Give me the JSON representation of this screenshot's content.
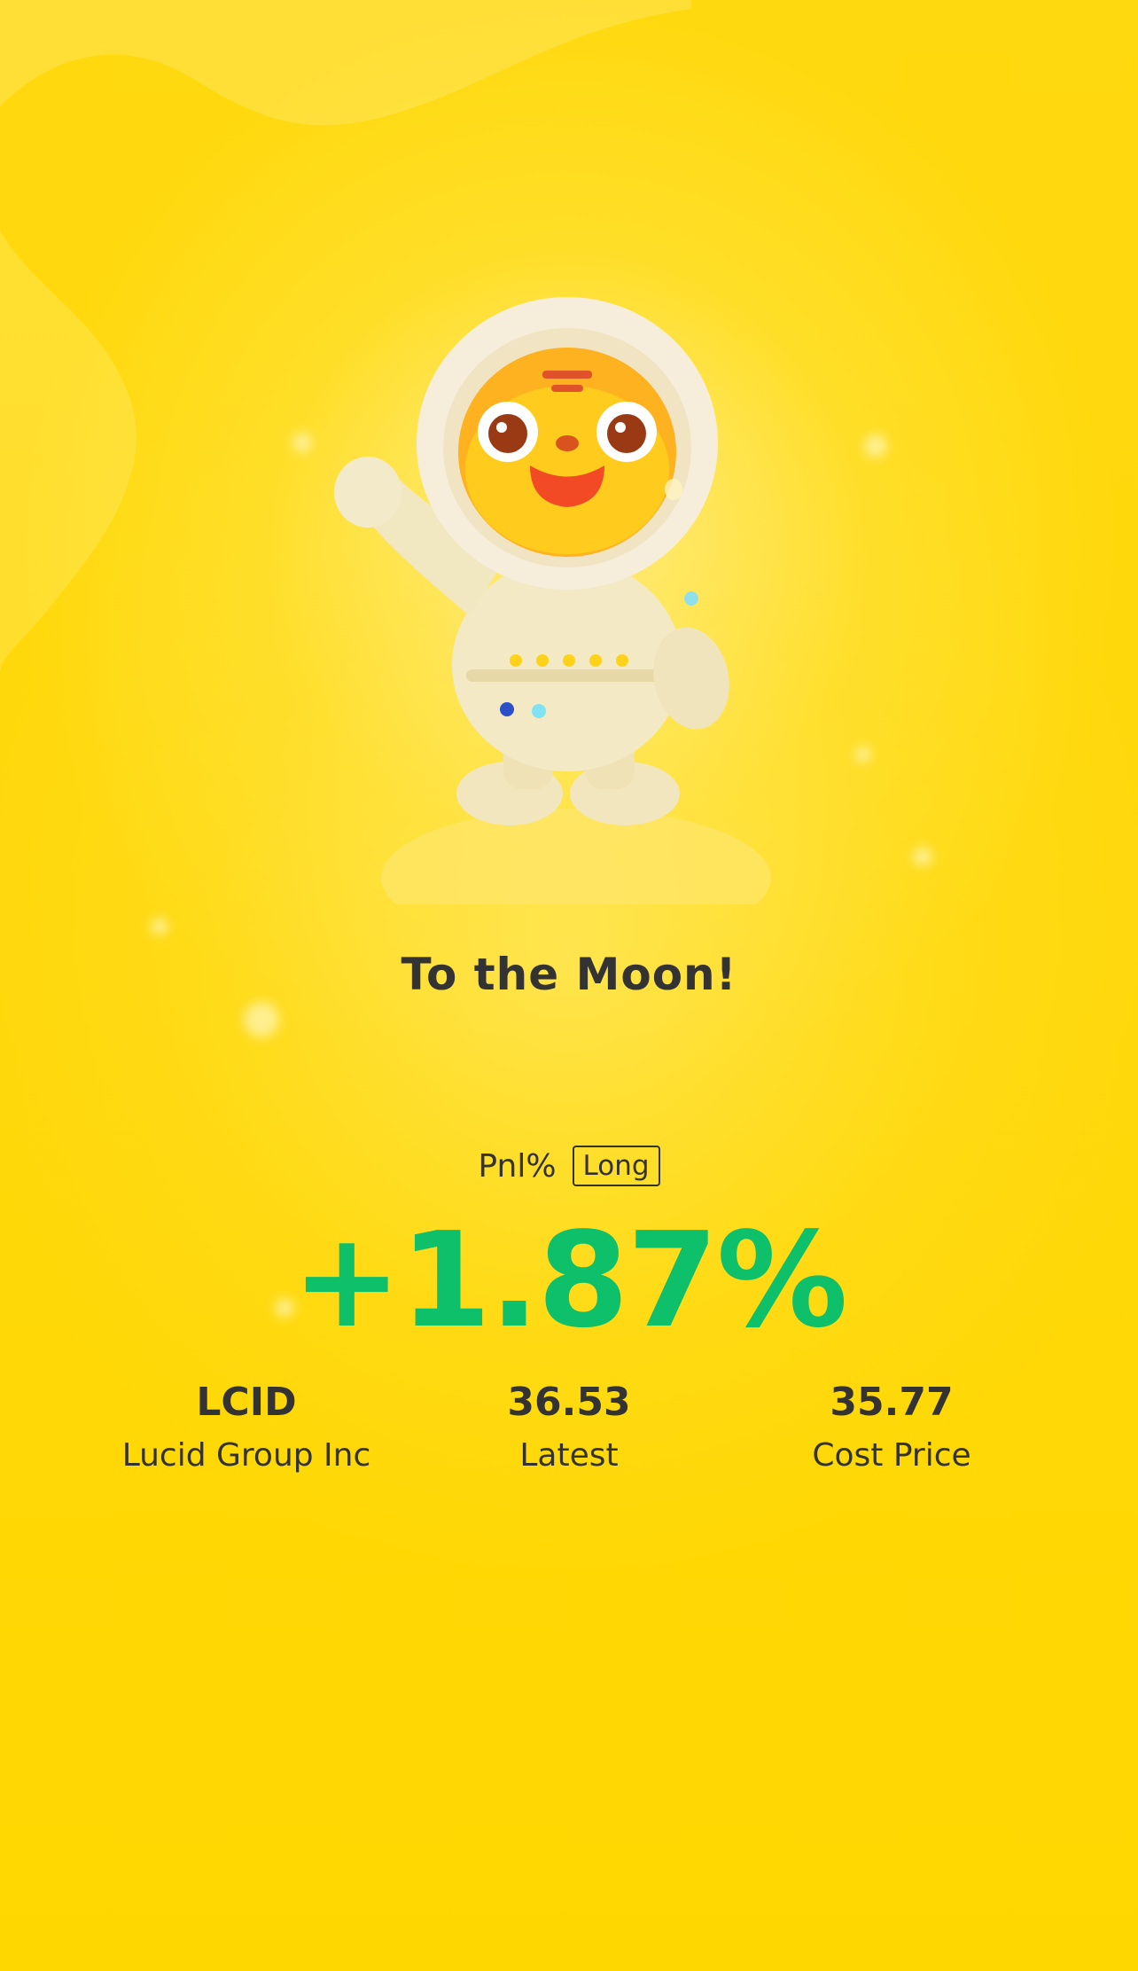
{
  "headline": "To the Moon!",
  "pnl": {
    "label": "Pnl%",
    "position_type": "Long",
    "value": "+1.87%"
  },
  "stats": [
    {
      "value": "LCID",
      "label": "Lucid Group Inc"
    },
    {
      "value": "36.53",
      "label": "Latest"
    },
    {
      "value": "35.77",
      "label": "Cost Price"
    }
  ],
  "colors": {
    "background": "#FFD90F",
    "text": "#333333",
    "gain": "#0EC06A"
  },
  "icons": {
    "mascot": "astronaut-tiger-mascot"
  }
}
